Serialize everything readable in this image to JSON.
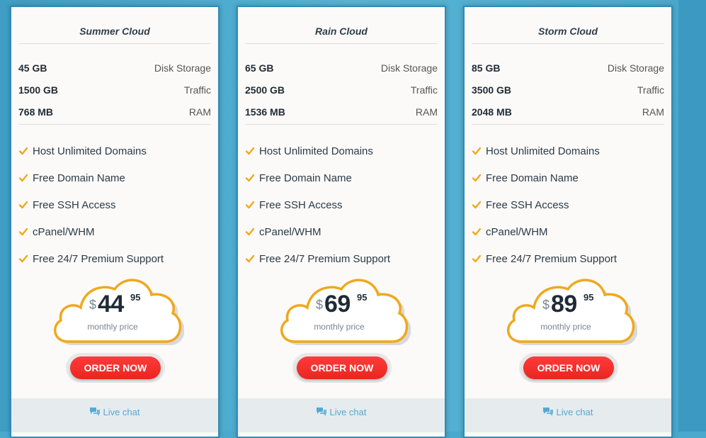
{
  "plans": [
    {
      "name": "Summer Cloud",
      "specs": [
        {
          "value": "45 GB",
          "label": "Disk Storage"
        },
        {
          "value": "1500 GB",
          "label": "Traffic"
        },
        {
          "value": "768 MB",
          "label": "RAM"
        }
      ],
      "features": [
        "Host Unlimited Domains",
        "Free Domain Name",
        "Free SSH Access",
        "cPanel/WHM",
        "Free 24/7 Premium Support"
      ],
      "price": {
        "currency": "$",
        "integer": "44",
        "decimal": "95",
        "period": "monthly price"
      },
      "order_label": "ORDER NOW",
      "chat_label": "Live chat"
    },
    {
      "name": "Rain Cloud",
      "specs": [
        {
          "value": "65 GB",
          "label": "Disk Storage"
        },
        {
          "value": "2500 GB",
          "label": "Traffic"
        },
        {
          "value": "1536 MB",
          "label": "RAM"
        }
      ],
      "features": [
        "Host Unlimited Domains",
        "Free Domain Name",
        "Free SSH Access",
        "cPanel/WHM",
        "Free 24/7 Premium Support"
      ],
      "price": {
        "currency": "$",
        "integer": "69",
        "decimal": "95",
        "period": "monthly price"
      },
      "order_label": "ORDER NOW",
      "chat_label": "Live chat"
    },
    {
      "name": "Storm Cloud",
      "specs": [
        {
          "value": "85 GB",
          "label": "Disk Storage"
        },
        {
          "value": "3500 GB",
          "label": "Traffic"
        },
        {
          "value": "2048 MB",
          "label": "RAM"
        }
      ],
      "features": [
        "Host Unlimited Domains",
        "Free Domain Name",
        "Free SSH Access",
        "cPanel/WHM",
        "Free 24/7 Premium Support"
      ],
      "price": {
        "currency": "$",
        "integer": "89",
        "decimal": "95",
        "period": "monthly price"
      },
      "order_label": "ORDER NOW",
      "chat_label": "Live chat"
    }
  ],
  "colors": {
    "background": "#4aa9cc",
    "card": "#fbfaf8",
    "check": "#f0a81c",
    "cloud_stroke": "#f0a81c",
    "order_button": "#f0342c",
    "chat_text": "#57a9cf"
  },
  "icons": {
    "feature": "check-icon",
    "chat": "chat-bubbles-icon",
    "price_frame": "cloud-icon"
  }
}
